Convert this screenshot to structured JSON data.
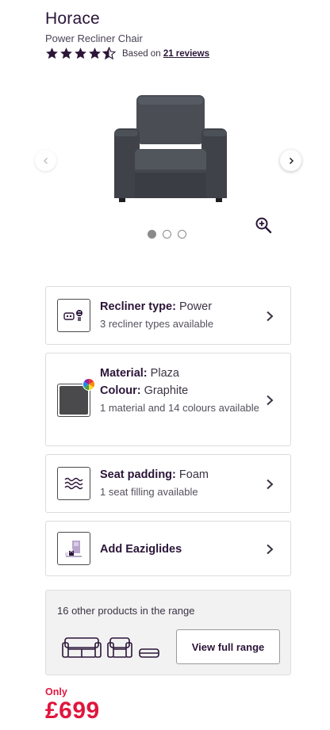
{
  "product": {
    "name": "Horace",
    "subtitle": "Power Recliner Chair",
    "rating_value": 4.5,
    "rating_max": 5,
    "reviews_prefix": "Based on",
    "reviews_link": "21 reviews",
    "star_color": "#2b1538"
  },
  "gallery": {
    "image_count": 3,
    "active_index": 0,
    "prev_icon": "chevron-left-icon",
    "next_icon": "chevron-right-icon",
    "zoom_icon": "zoom-in-icon"
  },
  "options": [
    {
      "label": "Recliner type:",
      "value": "Power",
      "detail": "3 recliner types available",
      "icon": "recliner-remote-icon"
    },
    {
      "label": "Material:",
      "value": "Plaza",
      "label2": "Colour:",
      "value2": "Graphite",
      "detail": "1 material and 14 colours available",
      "icon": "fabric-swatch-icon"
    },
    {
      "label": "Seat padding:",
      "value": "Foam",
      "detail": "1 seat filling available",
      "icon": "seat-padding-icon"
    },
    {
      "label": "Add Eaziglides",
      "icon": "eaziglides-icon"
    }
  ],
  "range": {
    "text": "16 other products in the range",
    "button": "View full range"
  },
  "price": {
    "prefix": "Only",
    "amount": "£699",
    "color": "#e0163d"
  }
}
